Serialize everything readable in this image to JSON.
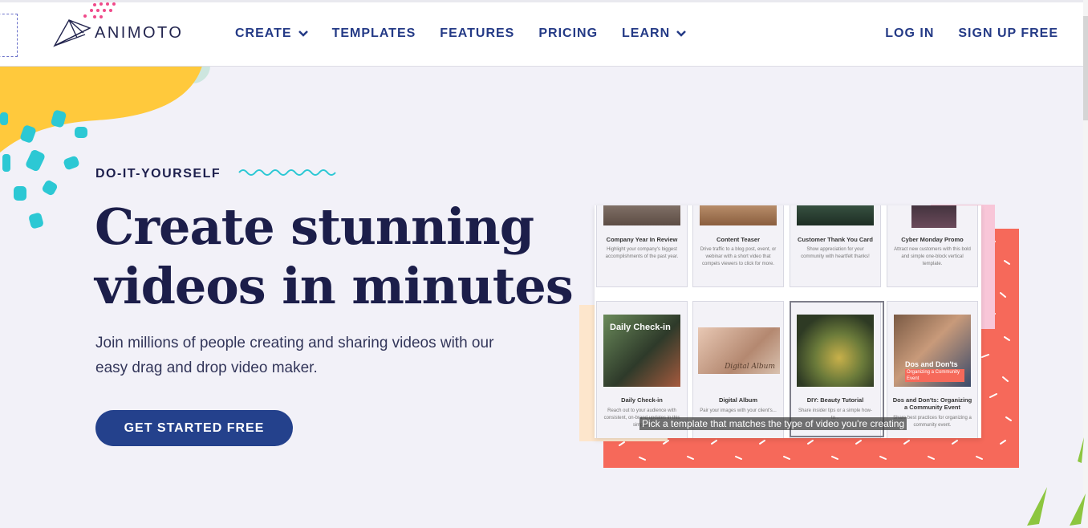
{
  "header": {
    "logo_text": "ANIMOTO",
    "nav": [
      {
        "label": "CREATE",
        "has_dropdown": true
      },
      {
        "label": "TEMPLATES",
        "has_dropdown": false
      },
      {
        "label": "FEATURES",
        "has_dropdown": false
      },
      {
        "label": "PRICING",
        "has_dropdown": false
      },
      {
        "label": "LEARN",
        "has_dropdown": true
      }
    ],
    "login_label": "LOG IN",
    "signup_label": "SIGN UP FREE"
  },
  "hero": {
    "eyebrow": "DO-IT-YOURSELF",
    "headline_line1": "Create stunning",
    "headline_line2": "videos in minutes",
    "subtext": "Join millions of people creating and sharing videos with our easy drag and drop video maker.",
    "cta_label": "GET STARTED FREE"
  },
  "preview": {
    "caption": "Pick a template that matches the type of video you're creating",
    "cards_top": [
      {
        "title": "Company Year In Review",
        "desc": "Highlight your company's biggest accomplishments of the past year."
      },
      {
        "title": "Content Teaser",
        "desc": "Drive traffic to a blog post, event, or webinar with a short video that compels viewers to click for more."
      },
      {
        "title": "Customer Thank You Card",
        "desc": "Show appreciation for your community with heartfelt thanks!"
      },
      {
        "title": "Cyber Monday Promo",
        "desc": "Attract new customers with this bold and simple one-block vertical template."
      }
    ],
    "cards_bottom": [
      {
        "title": "Daily Check-in",
        "desc": "Reach out to your audience with consistent, on-brand updates in this simple...",
        "thumb_label": "Daily Check-in"
      },
      {
        "title": "Digital Album",
        "desc": "Pair your images with your client's..."
      },
      {
        "title": "DIY: Beauty Tutorial",
        "desc": "Share insider tips or a simple how-to..."
      },
      {
        "title": "Dos and Don'ts: Organizing a Community Event",
        "desc": "Share best practices for organizing a community event.",
        "thumb_label": "Dos and Don'ts",
        "thumb_sublabel": "Organizing a Community Event"
      }
    ],
    "album_script": "Digital Album"
  },
  "colors": {
    "brand_navy": "#24418c",
    "heading": "#1c1e4a",
    "background": "#f2f1f8",
    "accent_yellow": "#ffc93c",
    "accent_teal": "#2cc8d4",
    "accent_coral": "#f6695a",
    "accent_pink": "#f8c6d8"
  }
}
